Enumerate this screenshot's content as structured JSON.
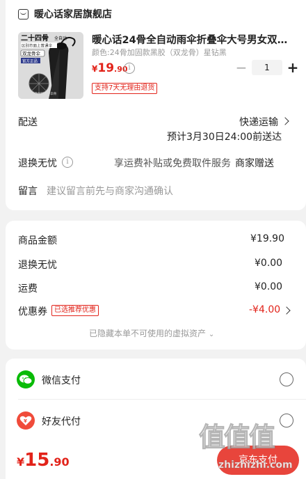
{
  "store": {
    "name": "暖心话家居旗舰店",
    "icon": "store-icon"
  },
  "product": {
    "title": "暖心话24骨全自动雨伞折叠伞大号男女双人...",
    "spec": "颜色:24骨加固款黑胶（双龙骨）星钻黑",
    "price_currency": "¥",
    "price_int": "19",
    "price_dec": ".90",
    "tag": "支持7天无理由退货",
    "quantity": "1",
    "thumb": {
      "badge_title": "二十四骨",
      "badge_sub": "全自动",
      "badge_line": "区别市面上普通伞",
      "badge2": "双龙骨伞",
      "badge3": "官方正品",
      "caption": "24骨加固钢骨伞骨"
    }
  },
  "delivery": {
    "label": "配送",
    "method": "快递运输",
    "eta": "预计3月30日24:00前送达"
  },
  "return_service": {
    "label": "退换无忧",
    "desc": "享运费补贴或免费取件服务",
    "provider": "商家赠送"
  },
  "note": {
    "label": "留言",
    "placeholder": "建议留言前先与商家沟通确认"
  },
  "price_detail": {
    "goods_label": "商品金额",
    "goods_value": "¥19.90",
    "return_label": "退换无忧",
    "return_value": "¥0.00",
    "freight_label": "运费",
    "freight_value": "¥0.00",
    "coupon_label": "优惠券",
    "coupon_tag": "已选推荐优惠",
    "coupon_value": "-¥4.00",
    "hidden_note": "已隐藏本单不可使用的虚拟资产"
  },
  "payment": {
    "wechat_label": "微信支付",
    "friend_label": "好友代付"
  },
  "footer": {
    "total_currency": "¥",
    "total_int": "15",
    "total_dec": ".90",
    "pay_button": "京东支付"
  },
  "watermark": {
    "glyphs": "值值值",
    "domain": "zhizhizhi.com"
  },
  "colors": {
    "accent": "#e2231a",
    "wechat": "#09bb07",
    "pay_button": "#e8453c"
  }
}
